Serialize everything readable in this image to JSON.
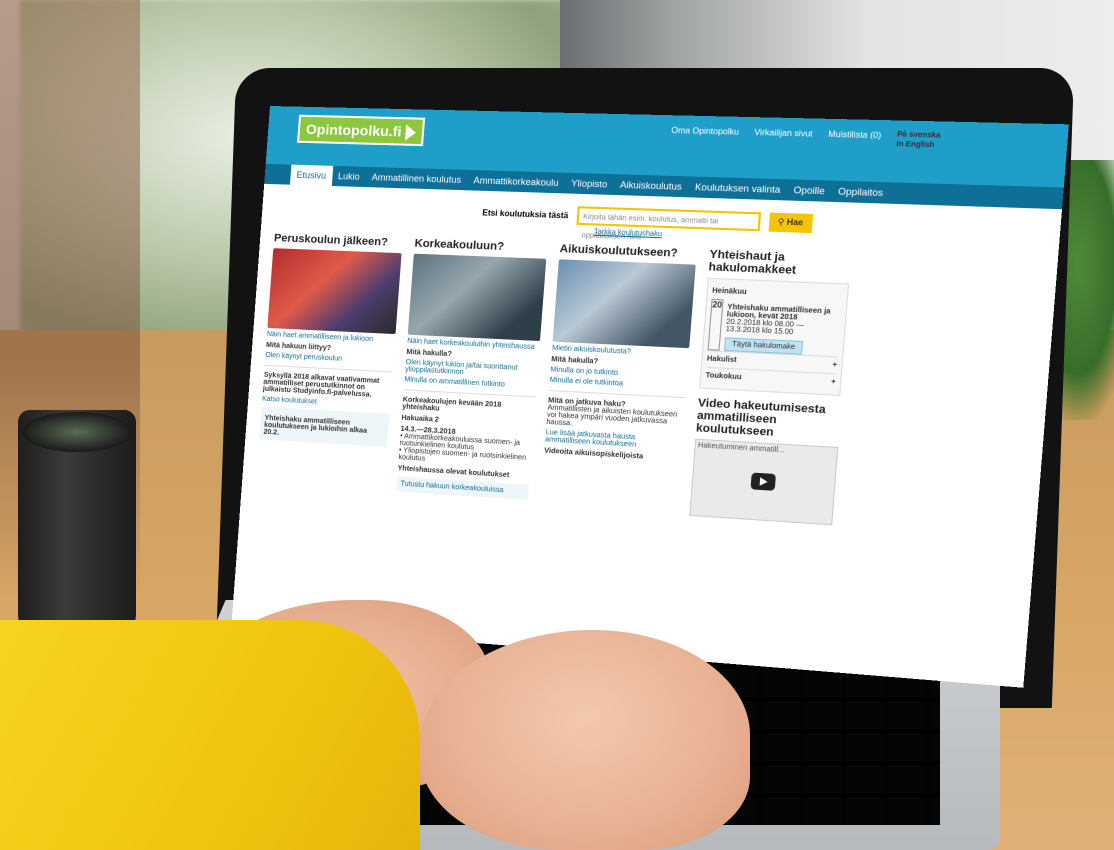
{
  "site": {
    "logo": "Opintopolku.fi",
    "utils": {
      "oma": "Oma Opintopolku",
      "virkailija": "Virkailijan sivut",
      "muistilista": "Muistilista (0)",
      "sv": "På svenska",
      "en": "In English"
    },
    "nav": [
      {
        "label": "Etusivu",
        "active": true
      },
      {
        "label": "Lukio"
      },
      {
        "label": "Ammatillinen koulutus"
      },
      {
        "label": "Ammattikorkeakoulu"
      },
      {
        "label": "Yliopisto"
      },
      {
        "label": "Aikuiskoulutus"
      },
      {
        "label": "Koulutuksen valinta"
      },
      {
        "label": "Opoille"
      },
      {
        "label": "Oppilaitos"
      }
    ],
    "search": {
      "label": "Etsi koulutuksia tästä",
      "placeholder": "Kirjoita tähän esim. koulutus, ammatti tai oppilaitoksen nimi",
      "button": "Hae",
      "advanced": "Tarkka koulutushaku"
    },
    "columns": [
      {
        "title": "Peruskoulun jälkeen?",
        "links": [
          "Näin haet ammatilliseen ja lukioon",
          "Mitä hakuun liittyy?",
          "Olen käynyt peruskoulun"
        ],
        "notice_title": "Syksyllä 2018 alkavat vaativammat ammatilliset perustutkinnot on julkaistu Studyinfo.fi-palvelussa.",
        "notice_link": "Katso koulutukset",
        "feature_title": "Yhteishaku ammatilliseen koulutukseen ja lukioihin alkaa 20.2."
      },
      {
        "title": "Korkeakouluun?",
        "links": [
          "Näin haet korkeakouluihin yhteishaussa",
          "Mitä hakulla?",
          "Olen käynyt lukion ja/tai suorittanut ylioppilastutkinnon",
          "Minulla on ammatillinen tutkinto"
        ],
        "section_title": "Korkeakoulujen kevään 2018 yhteishaku",
        "section_sub": "Hakuaika 2",
        "section_dates": "14.3.—28.3.2018",
        "bullets": [
          "Ammattikorkeakouluissa suomen- ja ruotsinkielinen koulutus",
          "Yliopistojen suomen- ja ruotsinkielinen koulutus"
        ],
        "extra_title": "Yhteishaussa olevat koulutukset",
        "extra_link": "Tutustu hakuun korkeakouluissa"
      },
      {
        "title": "Aikuiskoulutukseen?",
        "links": [
          "Mietin aikuiskoulutusta?",
          "Mitä hakulla?",
          "Minulla on jo tutkinto",
          "Minulla ei ole tutkintoa"
        ],
        "section_title": "Mitä on jatkuva haku?",
        "section_text": "Ammatillisten ja aikuisten koulutukseen voi hakea ympäri vuoden jatkuvassa haussa.",
        "section_link": "Lue lisää jatkuvasta hausta ammatilliseen koulutukseen",
        "video_title": "Videoita aikuisopiskelijoista"
      },
      {
        "title": "Yhteishaut ja hakulomakkeet",
        "panel_header": "Heinäkuu",
        "event_day": "20",
        "event_title": "Yhteishaku ammatilliseen ja lukioon, kevät 2018",
        "event_dates": "20.2.2018 klo 08.00 — 13.3.2018 klo 15.00",
        "event_button": "Täytä hakulomake",
        "rows": [
          "Hakulist",
          "Toukokuu"
        ],
        "video_heading": "Video hakeutumisesta ammatilliseen koulutukseen",
        "video_caption": "Hakeutuminen ammatill..."
      }
    ]
  }
}
